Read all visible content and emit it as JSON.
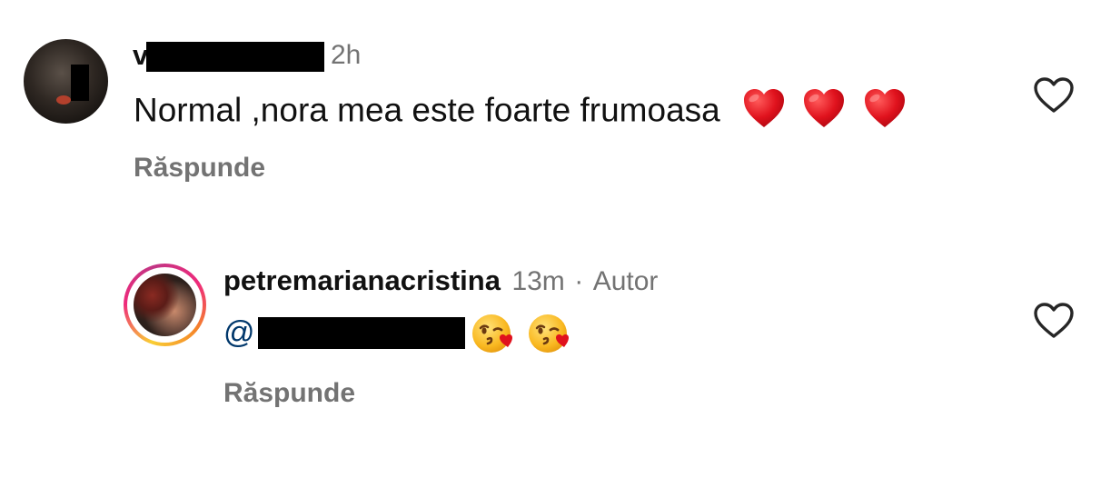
{
  "comments": [
    {
      "username_visible": "v",
      "time": "2h",
      "text": "Normal ,nora mea este foarte frumoasa",
      "emojis": [
        "❤️",
        "❤️",
        "❤️"
      ],
      "reply_label": "Răspunde",
      "liked": false
    },
    {
      "username": "petremarianacristina",
      "time": "13m",
      "separator": "·",
      "author_badge": "Autor",
      "mention_prefix": "@",
      "emojis": [
        "😘",
        "😘"
      ],
      "reply_label": "Răspunde",
      "liked": false
    }
  ],
  "icons": {
    "like": "heart-outline-icon"
  },
  "colors": {
    "secondary_text": "#737373",
    "mention": "#00376b",
    "heart_emoji": "#e0121d",
    "story_ring_start": "#f9ce34",
    "story_ring_end": "#ee2a7b"
  }
}
